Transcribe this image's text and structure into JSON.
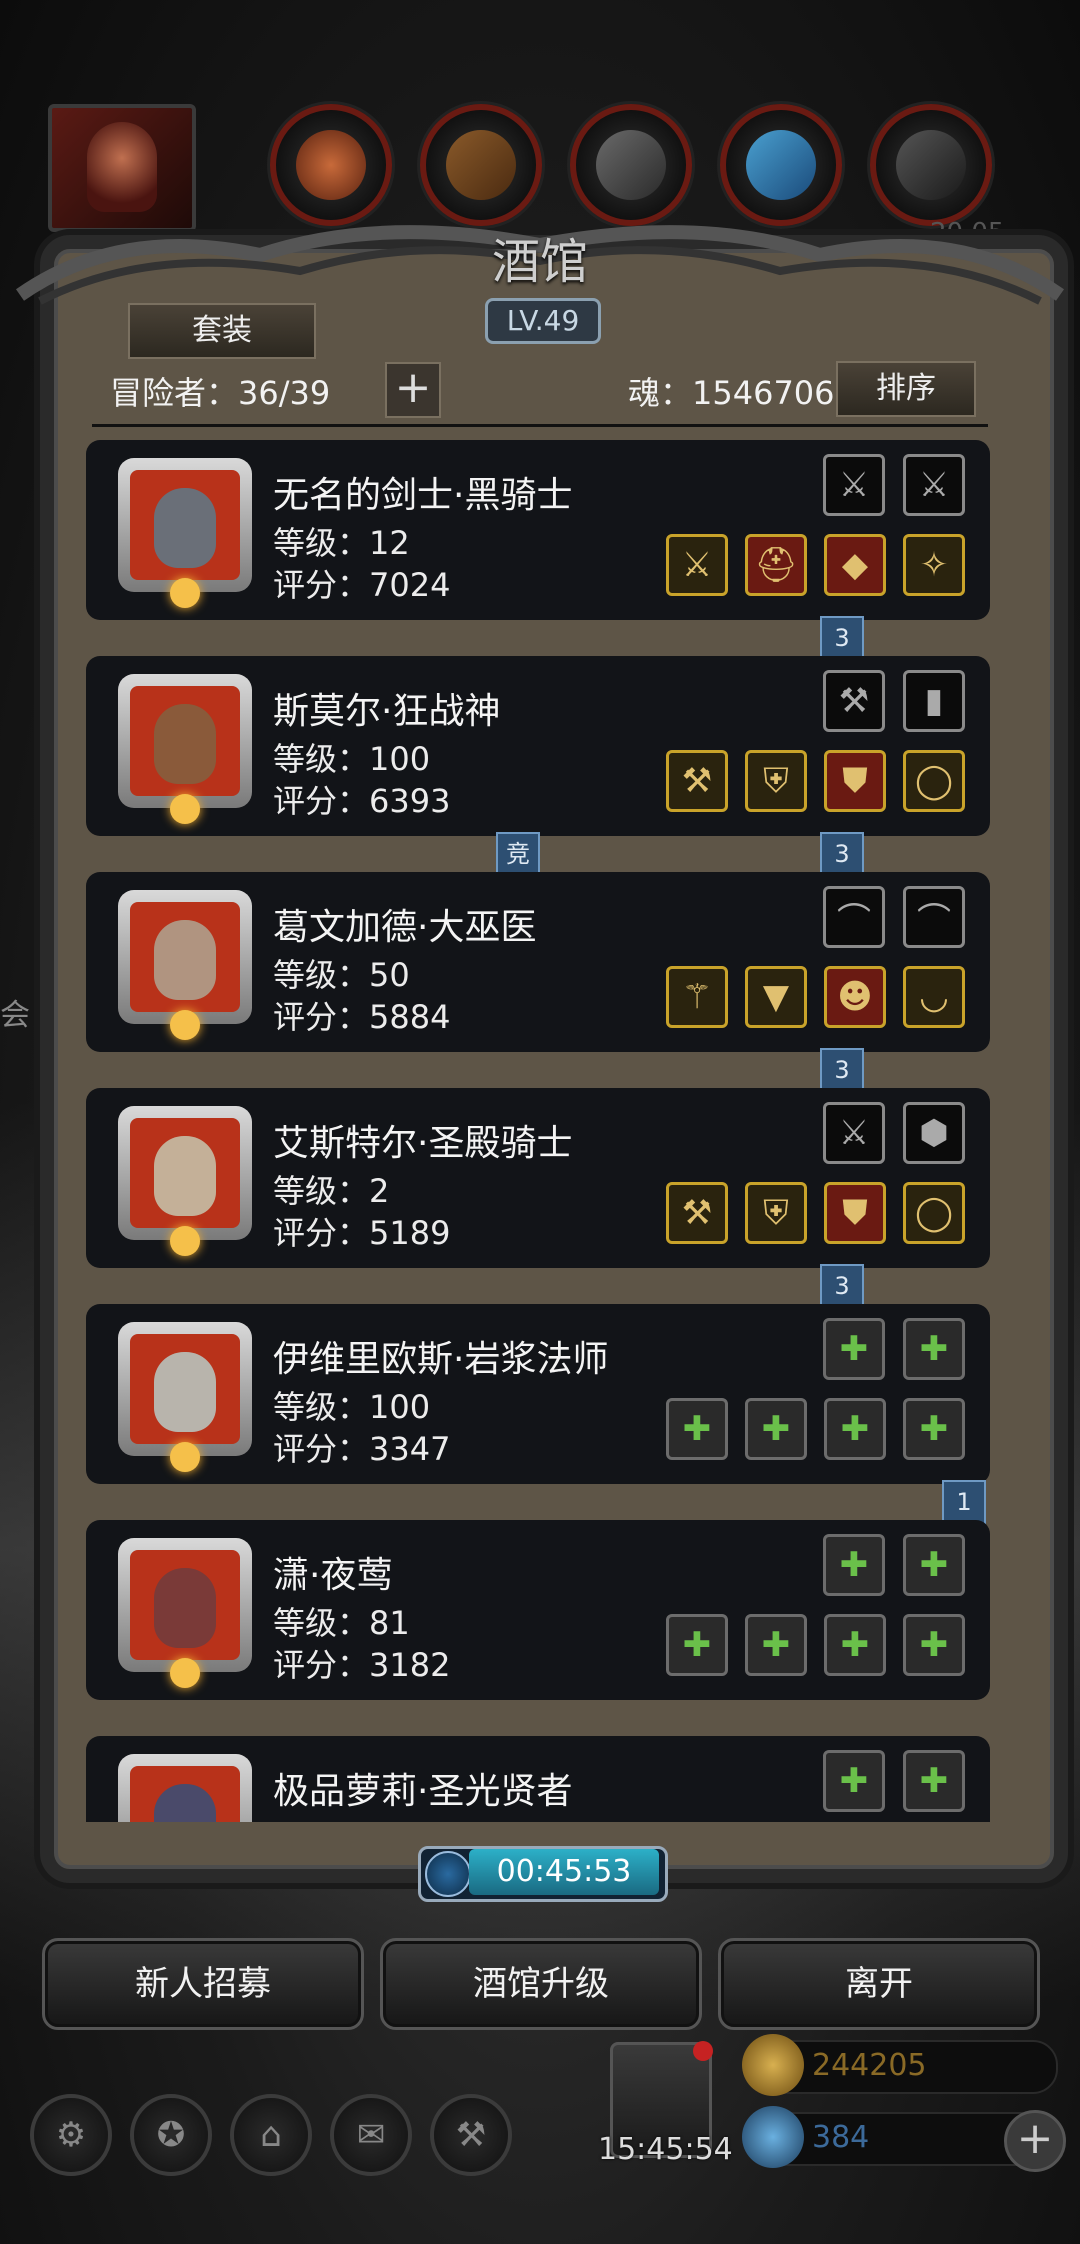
{
  "window": {
    "title": "酒馆",
    "level": "LV.49"
  },
  "header": {
    "set_label": "套装",
    "adventurer_count": "冒险者：36/39",
    "add_symbol": "+",
    "soul_label": "魂：1546706",
    "sort_label": "排序"
  },
  "top_number": "20.05",
  "side_text": "会",
  "heroes": [
    {
      "name": "无名的剑士·黑骑士",
      "level": "等级：12",
      "score": "评分：7024",
      "badge": "3",
      "portrait_color": "#6a6f78",
      "slots_top": [
        "sword-icon",
        "sword-icon"
      ],
      "slots_bottom": [
        "sword-icon",
        "helmet-icon",
        "gem-icon",
        "amulet-icon"
      ]
    },
    {
      "name": "斯莫尔·狂战神",
      "level": "等级：100",
      "score": "评分：6393",
      "badge": "3",
      "badge2": "竞",
      "portrait_color": "#8a5a3a",
      "slots_top": [
        "axe-icon",
        "rune-icon"
      ],
      "slots_bottom": [
        "axe-icon",
        "armor-icon",
        "shield-icon",
        "ring-icon"
      ]
    },
    {
      "name": "葛文加德·大巫医",
      "level": "等级：50",
      "score": "评分：5884",
      "badge": "3",
      "portrait_color": "#b09480",
      "slots_top": [
        "bow-icon",
        "bow-icon"
      ],
      "slots_bottom": [
        "staff-icon",
        "robe-icon",
        "mask-icon",
        "necklace-icon"
      ]
    },
    {
      "name": "艾斯特尔·圣殿骑士",
      "level": "等级：2",
      "score": "评分：5189",
      "badge": "3",
      "portrait_color": "#c4b098",
      "slots_top": [
        "sword-icon",
        "crest-icon"
      ],
      "slots_bottom": [
        "hammer-icon",
        "armor-icon",
        "shield-icon",
        "ring-icon"
      ]
    },
    {
      "name": "伊维里欧斯·岩浆法师",
      "level": "等级：100",
      "score": "评分：3347",
      "badge": "1",
      "portrait_color": "#b8b4ac",
      "slots_top": [
        "empty-slot-icon",
        "empty-slot-icon"
      ],
      "slots_bottom": [
        "empty-slot-icon",
        "empty-slot-icon",
        "empty-slot-icon",
        "empty-slot-icon"
      ]
    },
    {
      "name": "潇·夜莺",
      "level": "等级：81",
      "score": "评分：3182",
      "badge": "",
      "portrait_color": "#7a3a38",
      "slots_top": [
        "empty-slot-icon",
        "empty-slot-icon"
      ],
      "slots_bottom": [
        "empty-slot-icon",
        "empty-slot-icon",
        "empty-slot-icon",
        "empty-slot-icon"
      ]
    },
    {
      "name": "极品萝莉·圣光贤者",
      "level": "",
      "score": "",
      "badge": "",
      "portrait_color": "#4a4a6a",
      "slots_top": [
        "empty-slot-icon",
        "empty-slot-icon"
      ],
      "slots_bottom": []
    }
  ],
  "timer": "00:45:53",
  "buttons": {
    "recruit": "新人招募",
    "upgrade": "酒馆升级",
    "leave": "离开"
  },
  "gift_time": "15:45:54",
  "resources": {
    "gold": "244205",
    "gem": "384",
    "gold_color": "#8a6a26",
    "gem_color": "#3c6a9a"
  }
}
